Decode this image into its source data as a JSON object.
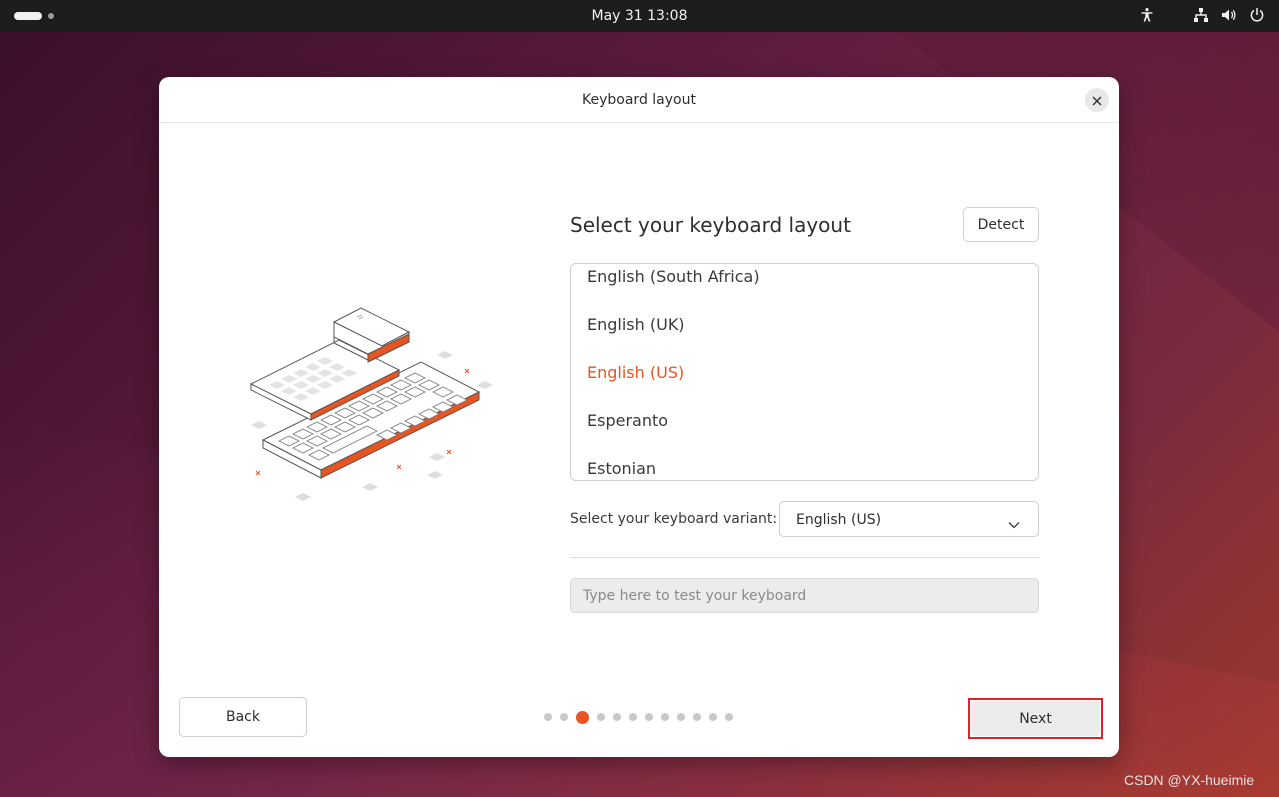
{
  "topbar": {
    "clock": "May 31  13:08",
    "tray_icons": [
      "accessibility-icon",
      "network-icon",
      "volume-icon",
      "power-icon"
    ]
  },
  "dialog": {
    "title": "Keyboard layout",
    "heading": "Select your keyboard layout",
    "detect_label": "Detect",
    "layouts": [
      {
        "label": "English (South Africa)",
        "selected": false
      },
      {
        "label": "English (UK)",
        "selected": false
      },
      {
        "label": "English (US)",
        "selected": true
      },
      {
        "label": "Esperanto",
        "selected": false
      },
      {
        "label": "Estonian",
        "selected": false
      }
    ],
    "variant_label": "Select your keyboard variant:",
    "variant_value": "English (US)",
    "test_placeholder": "Type here to test your keyboard",
    "back_label": "Back",
    "next_label": "Next",
    "progress": {
      "total": 12,
      "current": 3
    }
  },
  "colors": {
    "accent": "#e95420",
    "highlight_box": "#e0202a"
  },
  "watermark": "CSDN @YX-hueimie"
}
